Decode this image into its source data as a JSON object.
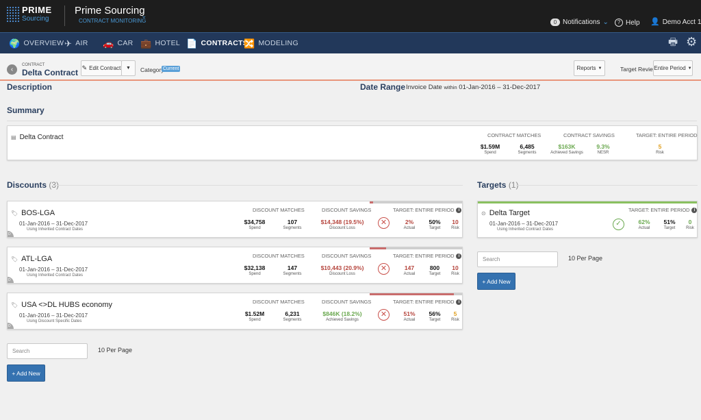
{
  "app": {
    "logo_top": "PRIME",
    "logo_bottom": "Sourcing",
    "title": "Prime Sourcing",
    "subtitle": "CONTRACT MONITORING",
    "notifications_count": "0",
    "notifications_label": "Notifications",
    "help_label": "Help",
    "account_label": "Demo Acct 1"
  },
  "nav": {
    "items": [
      {
        "label": "OVERVIEW",
        "icon": "globe-icon"
      },
      {
        "label": "AIR",
        "icon": "plane-icon"
      },
      {
        "label": "CAR",
        "icon": "car-icon"
      },
      {
        "label": "HOTEL",
        "icon": "suitcase-icon"
      },
      {
        "label": "CONTRACTS",
        "icon": "document-icon"
      },
      {
        "label": "MODELING",
        "icon": "shuffle-icon"
      }
    ]
  },
  "context": {
    "small_label": "CONTRACT",
    "contract_name": "Delta Contract",
    "edit_label": "Edit Contract",
    "category_label": "Category:",
    "category_value": "Current",
    "reports_label": "Reports",
    "target_review_label": "Target Review:",
    "target_review_value": "Entire Period"
  },
  "description": {
    "title": "Description",
    "date_range_title": "Date Range",
    "date_prefix": "Invoice Date",
    "date_within": "within",
    "date_range_value": "01-Jan-2016 – 31-Dec-2017"
  },
  "summary": {
    "title": "Summary",
    "contract_name": "Delta Contract",
    "matches_head": "CONTRACT MATCHES",
    "savings_head": "CONTRACT SAVINGS",
    "target_head": "TARGET: ENTIRE PERIOD",
    "spend": "$1.59M",
    "spend_label": "Spend",
    "segments": "6,485",
    "segments_label": "Segments",
    "achieved": "$163K",
    "achieved_label": "Achieved Savings",
    "nesr": "9.3%",
    "nesr_label": "NESR",
    "risk": "5",
    "risk_label": "Risk"
  },
  "discounts": {
    "title": "Discounts",
    "count": "(3)",
    "matches_head": "DISCOUNT MATCHES",
    "savings_head": "DISCOUNT SAVINGS",
    "target_head": "TARGET: ENTIRE PERIOD",
    "spend_label": "Spend",
    "segments_label": "Segments",
    "actual_label": "Actual",
    "target_label": "Target",
    "risk_label": "Risk",
    "search_placeholder": "Search",
    "per_page": "10 Per Page",
    "add_new": "+ Add New",
    "items": [
      {
        "name": "BOS-LGA",
        "dates": "01-Jan-2016 – 31-Dec-2017",
        "date_note": "Using Inherited Contract Dates",
        "spend": "$34,758",
        "segments": "107",
        "savings": "$14,348 (19.5%)",
        "savings_label": "Discount Loss",
        "actual": "2%",
        "target": "50%",
        "risk": "10",
        "progress": 0.04
      },
      {
        "name": "ATL-LGA",
        "dates": "01-Jan-2016 – 31-Dec-2017",
        "date_note": "Using Inherited Contract Dates",
        "spend": "$32,138",
        "segments": "147",
        "savings": "$10,443 (20.9%)",
        "savings_label": "Discount Loss",
        "actual": "147",
        "target": "800",
        "risk": "10",
        "progress": 0.18
      },
      {
        "name": "USA <>DL HUBS economy",
        "dates": "01-Jan-2016 – 31-Dec-2017",
        "date_note": "Using Discount Specific Dates",
        "spend": "$1.52M",
        "segments": "6,231",
        "savings": "$846K (18.2%)",
        "savings_label": "Achieved Savings",
        "actual": "51%",
        "target": "56%",
        "risk": "5",
        "progress": 0.91
      }
    ]
  },
  "targets": {
    "title": "Targets",
    "count": "(1)",
    "target_head": "TARGET: ENTIRE PERIOD",
    "item": {
      "name": "Delta Target",
      "dates": "01-Jan-2016 – 31-Dec-2017",
      "date_note": "Using Inherited Contract Dates",
      "actual": "62%",
      "actual_label": "Actual",
      "target": "51%",
      "target_label": "Target",
      "risk": "0",
      "risk_label": "Risk"
    },
    "search_placeholder": "Search",
    "per_page": "10 Per Page",
    "add_new": "+ Add New"
  },
  "colors": {
    "accent": "#3572b0",
    "nav": "#22385a",
    "loss": "#b5443c",
    "gain": "#6aa84f",
    "risk_mid": "#e0a020"
  }
}
